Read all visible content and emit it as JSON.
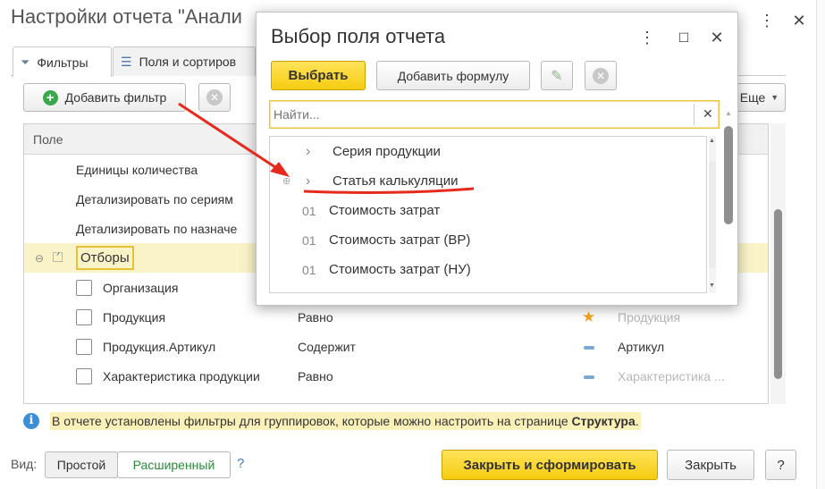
{
  "main": {
    "title": "Настройки отчета \"Анали",
    "tabs": [
      {
        "label": "Фильтры",
        "icon": "funnel-icon"
      },
      {
        "label": "Поля и сортиров",
        "icon": "columns-icon"
      }
    ],
    "toolbar": {
      "add_filter_label": "Добавить фильтр",
      "more_label": "Еще"
    },
    "grid": {
      "header_field": "Поле",
      "rows": [
        {
          "field": "Единицы количества"
        },
        {
          "field": "Детализировать по сериям"
        },
        {
          "field": "Детализировать по назначе"
        },
        {
          "field": "Отборы"
        },
        {
          "field": "Организация",
          "condition": "",
          "value": ""
        },
        {
          "field": "Продукция",
          "condition": "Равно",
          "value": "Продукция"
        },
        {
          "field": "Продукция.Артикул",
          "condition": "Содержит",
          "value": "Артикул"
        },
        {
          "field": "Характеристика продукции",
          "condition": "Равно",
          "value": "Характеристика ..."
        }
      ]
    },
    "info": {
      "text": "В отчете установлены фильтры для группировок, которые можно настроить на странице",
      "link": "Структура",
      "tail": "."
    },
    "footer": {
      "view_label": "Вид:",
      "simple_label": "Простой",
      "extended_label": "Расширенный",
      "help_label": "?",
      "close_generate_label": "Закрыть и сформировать",
      "close_label": "Закрыть",
      "question_label": "?"
    },
    "colors": {
      "accent_yellow": "#f6cc10",
      "link_green": "#2a8a3a",
      "info_blue": "#3b8fd6",
      "star": "#f5a623"
    }
  },
  "dialog": {
    "title": "Выбор поля отчета",
    "select_label": "Выбрать",
    "add_formula_label": "Добавить формулу",
    "search_placeholder": "Найти...",
    "items": [
      {
        "label": "Серия продукции",
        "kind": "group"
      },
      {
        "label": "Статья калькуляции",
        "kind": "group"
      },
      {
        "label": "Стоимость затрат",
        "kind": "number",
        "prefix": "01"
      },
      {
        "label": "Стоимость затрат (ВР)",
        "kind": "number",
        "prefix": "01"
      },
      {
        "label": "Стоимость затрат (НУ)",
        "kind": "number",
        "prefix": "01"
      }
    ]
  }
}
